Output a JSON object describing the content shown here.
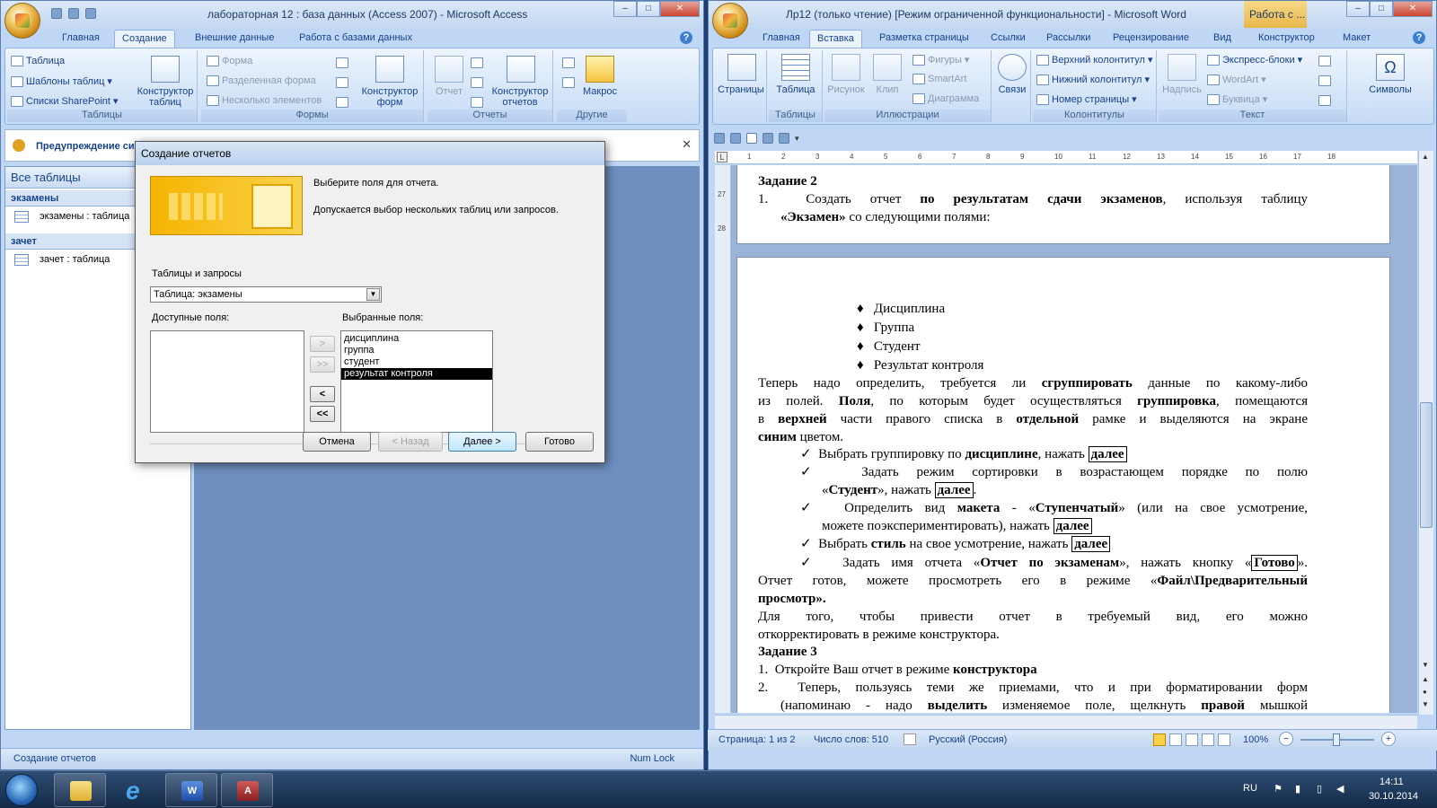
{
  "access": {
    "title": "лабораторная 12 : база данных (Access 2007) - Microsoft Access",
    "tabs": [
      "Главная",
      "Создание",
      "Внешние данные",
      "Работа с базами данных"
    ],
    "ribbon": {
      "tables_group": {
        "label": "Таблицы",
        "table": "Таблица",
        "table_templates": "Шаблоны таблиц",
        "sharepoint_lists": "Списки SharePoint",
        "table_designer": "Конструктор таблиц"
      },
      "forms_group": {
        "label": "Формы",
        "form": "Форма",
        "split_form": "Разделенная форма",
        "multiple_items": "Несколько элементов",
        "form_designer": "Конструктор форм"
      },
      "reports_group": {
        "label": "Отчеты",
        "report": "Отчет",
        "report_designer": "Конструктор отчетов"
      },
      "other_group": {
        "label": "Другие",
        "macro": "Макрос"
      }
    },
    "warning": "Предупреждение си",
    "nav": {
      "header": "Все таблицы",
      "groups": [
        {
          "name": "экзамены",
          "item": "экзамены : таблица"
        },
        {
          "name": "зачет",
          "item": "зачет : таблица"
        }
      ]
    },
    "status": {
      "left": "Создание отчетов",
      "right": "Num Lock"
    }
  },
  "dialog": {
    "title": "Создание отчетов",
    "instruction": "Выберите поля для отчета.",
    "hint": "Допускается выбор нескольких таблиц или запросов.",
    "tables_label": "Таблицы и запросы",
    "table_value": "Таблица: экзамены",
    "available_label": "Доступные поля:",
    "selected_label": "Выбранные поля:",
    "selected_fields": [
      "дисциплина",
      "группа",
      "студент",
      "результат контроля"
    ],
    "move_buttons": [
      ">",
      ">>",
      "<",
      "<<"
    ],
    "buttons": {
      "cancel": "Отмена",
      "back": "< Назад",
      "next": "Далее >",
      "finish": "Готово"
    }
  },
  "word": {
    "title": "Лр12 (только чтение) [Режим ограниченной функциональности] - Microsoft Word",
    "context_title": "Работа с ...",
    "tabs": [
      "Главная",
      "Вставка",
      "Разметка страницы",
      "Ссылки",
      "Рассылки",
      "Рецензирование",
      "Вид",
      "Конструктор",
      "Макет"
    ],
    "ribbon": {
      "pages": "Страницы",
      "tables": {
        "label": "Таблицы",
        "table": "Таблица"
      },
      "illustrations": {
        "label": "Иллюстрации",
        "picture": "Рисунок",
        "clip": "Клип",
        "shapes": "Фигуры",
        "smartart": "SmartArt",
        "chart": "Диаграмма"
      },
      "links": "Связи",
      "headers": {
        "label": "Колонтитулы",
        "header": "Верхний колонтитул",
        "footer": "Нижний колонтитул",
        "page_number": "Номер страницы"
      },
      "text": {
        "label": "Текст",
        "textbox": "Надпись",
        "quickparts": "Экспресс-блоки",
        "wordart": "WordArt",
        "dropcap": "Буквица"
      },
      "symbols": "Символы"
    },
    "ruler_ticks": [
      "1",
      "2",
      "3",
      "4",
      "5",
      "6",
      "7",
      "8",
      "9",
      "10",
      "11",
      "12",
      "13",
      "14",
      "15",
      "16",
      "17",
      "18"
    ],
    "vruler_ticks": [
      "27",
      "28"
    ],
    "doc": {
      "task2": "Задание 2",
      "l1_num": "1.",
      "l1a": "Создать",
      "l1b": "отчет",
      "l1c": "по результатам сдачи экзаменов",
      "l1d": ", используя таблицу",
      "l2a": "«Экзамен»",
      "l2b": " со следующими полями:",
      "bullets": [
        "Дисциплина",
        "Группа",
        "Студент",
        "Результат контроля"
      ],
      "p1_1a": "Теперь надо определить, требуется ли ",
      "p1_1b": "сгруппировать",
      "p1_1c": " данные по какому-либо",
      "p1_2a": "из полей. ",
      "p1_2b": "Поля",
      "p1_2c": ", по которым будет осуществляться ",
      "p1_2d": "группировка",
      "p1_2e": ", помещаются",
      "p1_3a": "в ",
      "p1_3b": "верхней",
      "p1_3c": " части правого списка в ",
      "p1_3d": "отдельной",
      "p1_3e": " рамке и выделяются на экране",
      "p1_4a": "синим",
      "p1_4b": " цветом.",
      "c1a": "Выбрать группировку по ",
      "c1b": "дисциплине",
      "c1c": ",  нажать ",
      "c1d": "далее",
      "c2_1": "Задать режим сортировки в возрастающем порядке по полю",
      "c2_2a": "«",
      "c2_2b": "Студент",
      "c2_2c": "», нажать ",
      "c2_2d": "далее",
      "c2_2e": ".",
      "c3_1a": "Определить вид ",
      "c3_1b": "макета",
      "c3_1c": " - «",
      "c3_1d": "Ступенчатый",
      "c3_1e": "» (или на свое усмотрение,",
      "c3_2a": "можете поэкспериментировать), нажать ",
      "c3_2b": "далее",
      "c4a": "Выбрать ",
      "c4b": "стиль",
      "c4c": " на свое усмотрение, нажать ",
      "c4d": "далее",
      "c5a": "Задать имя отчета «",
      "c5b": "Отчет по экзаменам",
      "c5c": "», нажать кнопку «",
      "c5d": "Готово",
      "c5e": "».",
      "p2_1a": "Отчет готов, можете просмотреть его в режиме «",
      "p2_1b": "Файл\\Предварительный",
      "p2_2": "просмотр».",
      "p3_1": "Для того, чтобы привести отчет в требуемый вид, его можно",
      "p3_2": "откорректировать в режиме конструктора.",
      "task3": "Задание 3",
      "t3_1num": "1.",
      "t3_1a": "Откройте Ваш отчет в режиме ",
      "t3_1b": "конструктора",
      "t3_2num": "2.",
      "t3_2": "Теперь, пользуясь теми же приемами, что и при форматировании форм",
      "t3_3a": "(напоминаю - надо ",
      "t3_3b": "выделить",
      "t3_3c": " изменяемое поле, щелкнуть ",
      "t3_3d": "правой",
      "t3_3e": " мышкой"
    },
    "status": {
      "page": "Страница: 1 из 2",
      "words": "Число слов: 510",
      "lang": "Русский (Россия)",
      "zoom": "100%"
    }
  },
  "taskbar": {
    "lang": "RU",
    "time": "14:11",
    "date": "30.10.2014"
  },
  "colors": {
    "ribbon_blue": "#bfd7f5",
    "accent_orange": "#f6b400",
    "taskbar": "#1c3a60"
  }
}
